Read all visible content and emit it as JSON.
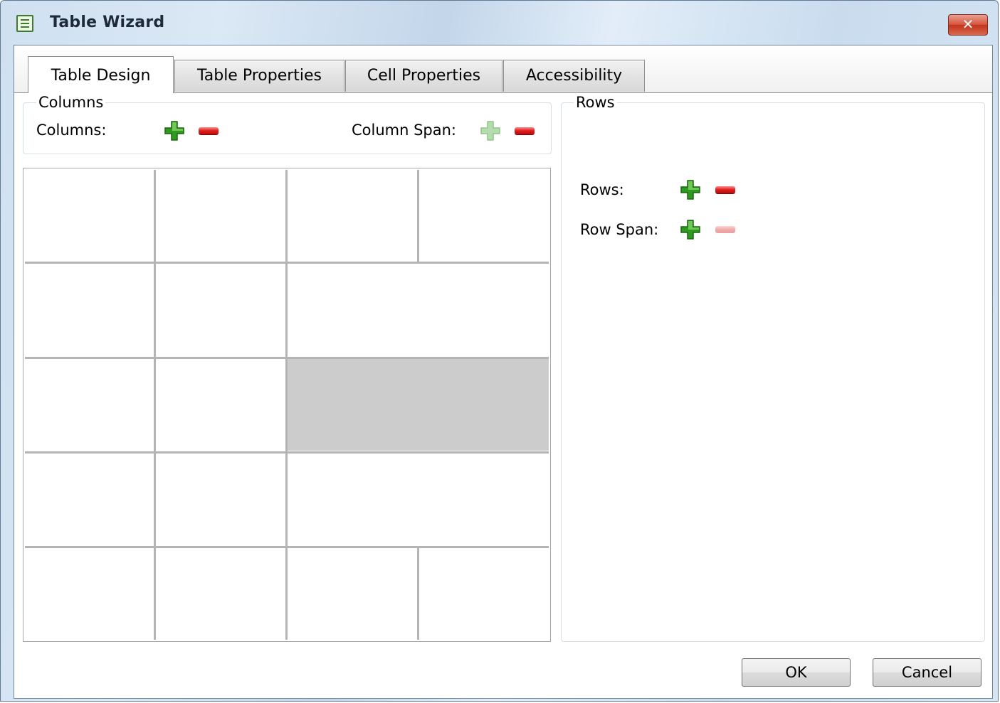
{
  "window": {
    "title": "Table Wizard",
    "close_glyph": "✕"
  },
  "tabs": [
    {
      "label": "Table Design",
      "active": true
    },
    {
      "label": "Table Properties",
      "active": false
    },
    {
      "label": "Cell Properties",
      "active": false
    },
    {
      "label": "Accessibility",
      "active": false
    }
  ],
  "columns_group": {
    "legend": "Columns",
    "columns_label": "Columns:",
    "column_span_label": "Column Span:"
  },
  "rows_group": {
    "legend": "Rows",
    "rows_label": "Rows:",
    "row_span_label": "Row Span:"
  },
  "buttons": {
    "ok": "OK",
    "cancel": "Cancel"
  },
  "icons": {
    "title": "table-wizard-icon",
    "add": "plus-icon",
    "remove": "minus-icon"
  },
  "colors": {
    "add_green": "#2e9a1f",
    "remove_red": "#e21b1b",
    "selected_cell": "#cccccc"
  }
}
